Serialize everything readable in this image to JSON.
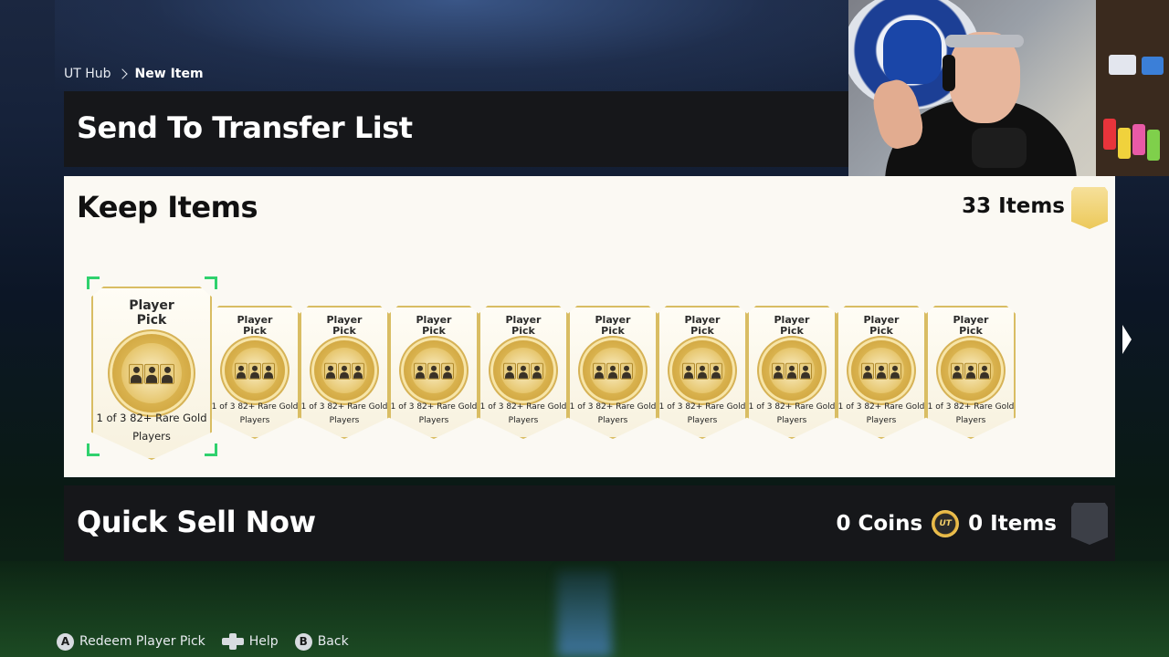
{
  "breadcrumb": {
    "root": "UT Hub",
    "current": "New Item"
  },
  "transfer_section": {
    "title": "Send To Transfer List"
  },
  "keep_section": {
    "title": "Keep Items",
    "count_label": "33 Items",
    "cards": [
      {
        "title_line1": "Player",
        "title_line2": "Pick",
        "desc_line1": "1 of 3 82+ Rare Gold",
        "desc_line2": "Players"
      },
      {
        "title_line1": "Player",
        "title_line2": "Pick",
        "desc_line1": "1 of 3 82+ Rare Gold",
        "desc_line2": "Players"
      },
      {
        "title_line1": "Player",
        "title_line2": "Pick",
        "desc_line1": "1 of 3 82+ Rare Gold",
        "desc_line2": "Players"
      },
      {
        "title_line1": "Player",
        "title_line2": "Pick",
        "desc_line1": "1 of 3 82+ Rare Gold",
        "desc_line2": "Players"
      },
      {
        "title_line1": "Player",
        "title_line2": "Pick",
        "desc_line1": "1 of 3 82+ Rare Gold",
        "desc_line2": "Players"
      },
      {
        "title_line1": "Player",
        "title_line2": "Pick",
        "desc_line1": "1 of 3 82+ Rare Gold",
        "desc_line2": "Players"
      },
      {
        "title_line1": "Player",
        "title_line2": "Pick",
        "desc_line1": "1 of 3 82+ Rare Gold",
        "desc_line2": "Players"
      },
      {
        "title_line1": "Player",
        "title_line2": "Pick",
        "desc_line1": "1 of 3 82+ Rare Gold",
        "desc_line2": "Players"
      },
      {
        "title_line1": "Player",
        "title_line2": "Pick",
        "desc_line1": "1 of 3 82+ Rare Gold",
        "desc_line2": "Players"
      },
      {
        "title_line1": "Player",
        "title_line2": "Pick",
        "desc_line1": "1 of 3 82+ Rare Gold",
        "desc_line2": "Players"
      }
    ]
  },
  "quick_sell_section": {
    "title": "Quick Sell Now",
    "coins_label": "0 Coins",
    "coin_icon_text": "UT",
    "items_label": "0 Items"
  },
  "footer_hints": [
    {
      "glyph": "A",
      "label": "Redeem Player Pick"
    },
    {
      "glyph": "dpad",
      "label": "Help"
    },
    {
      "glyph": "B",
      "label": "Back"
    }
  ],
  "colors": {
    "focus": "#2fd16d",
    "gold": "#ecc95a",
    "panel_dark": "#16171a",
    "panel_light": "#fbf9f3"
  },
  "icons": {
    "breadcrumb_separator": "chevron-right-icon",
    "keep_badge": "gold-pack-badge-icon",
    "coin": "ut-coin-icon",
    "quick_sell_badge": "grey-pack-badge-icon",
    "next": "arrow-right-icon"
  }
}
